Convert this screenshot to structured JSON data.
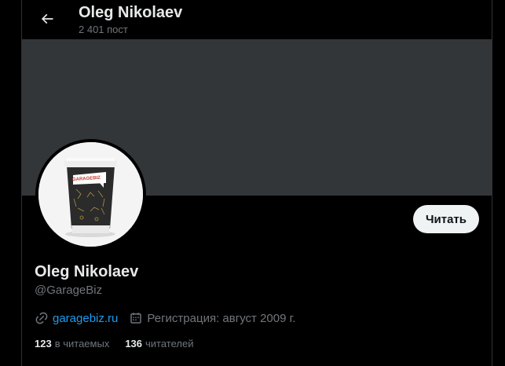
{
  "header": {
    "name": "Oleg Nikolaev",
    "post_count": "2 401 пост"
  },
  "profile": {
    "display_name": "Oleg Nikolaev",
    "handle": "@GarageBiz",
    "follow_label": "Читать",
    "avatar_brand": "GARAGEBIZ",
    "website": "garagebiz.ru",
    "joined": "Регистрация: август 2009 г."
  },
  "stats": {
    "following_count": "123",
    "following_label": "в читаемых",
    "followers_count": "136",
    "followers_label": "читателей"
  },
  "colors": {
    "background": "#000000",
    "banner": "#333639",
    "link": "#1d9bf0",
    "muted": "#71767b",
    "text": "#e7e9ea",
    "button_bg": "#eff3f4"
  },
  "icons": {
    "back": "arrow-left-icon",
    "link": "link-icon",
    "calendar": "calendar-icon"
  }
}
